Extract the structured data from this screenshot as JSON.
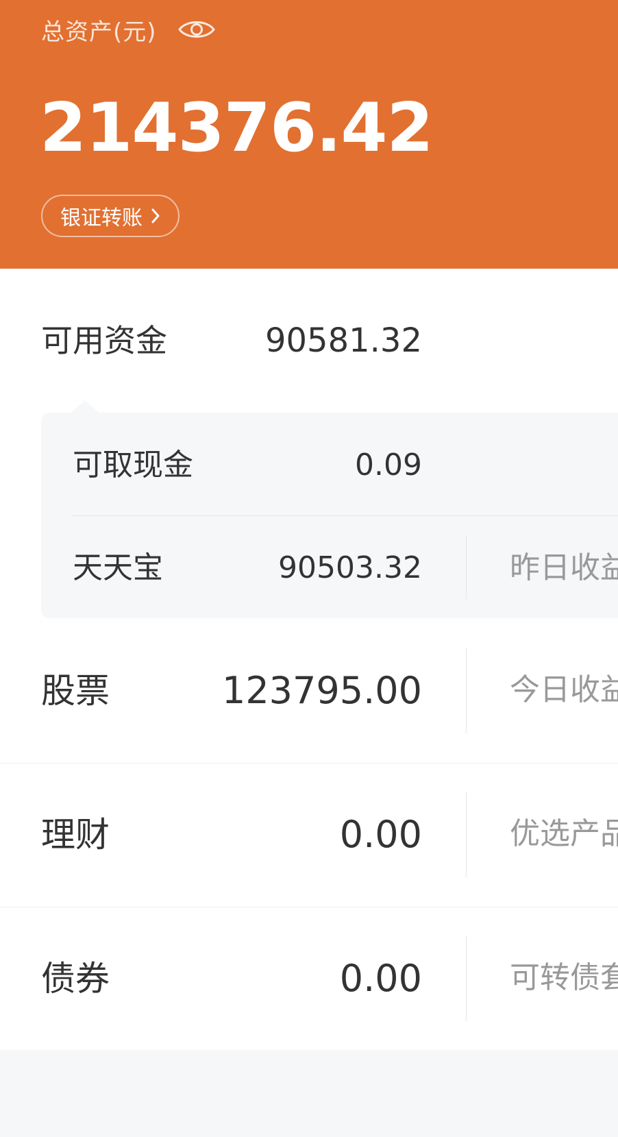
{
  "header": {
    "total_label": "总资产(元)",
    "total_value": "214376.42",
    "transfer_label": "银证转账",
    "accent_color": "#e27031"
  },
  "available": {
    "label": "可用资金",
    "value": "90581.32"
  },
  "subcard": {
    "withdrawable_label": "可取现金",
    "withdrawable_value": "0.09",
    "tiantianbao_label": "天天宝",
    "tiantianbao_value": "90503.32",
    "tiantianbao_side": "昨日收益"
  },
  "rows": [
    {
      "label": "股票",
      "value": "123795.00",
      "side": "今日收益"
    },
    {
      "label": "理财",
      "value": "0.00",
      "side": "优选产品"
    },
    {
      "label": "债券",
      "value": "0.00",
      "side": "可转债套"
    }
  ],
  "icons": {
    "visibility": "eye-icon",
    "transfer_arrow": "chevron-right-icon"
  }
}
